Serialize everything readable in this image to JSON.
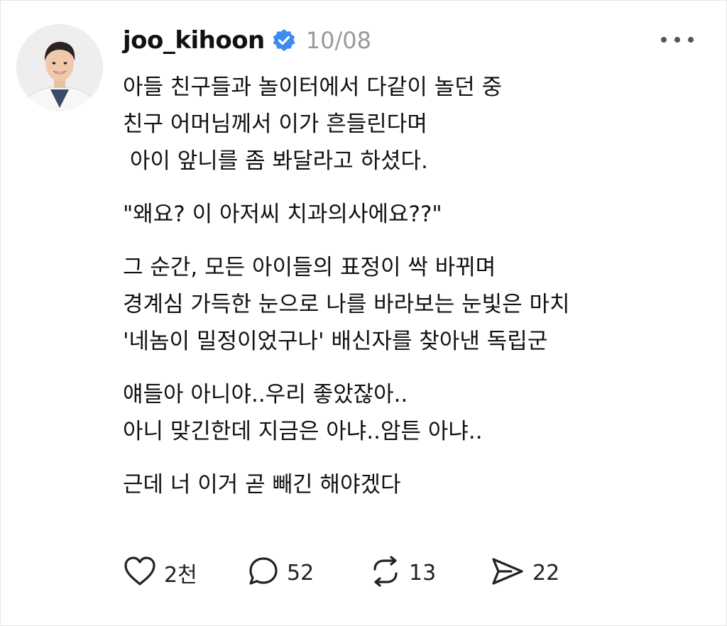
{
  "author": {
    "username": "joo_kihoon",
    "timestamp": "10/08"
  },
  "post": {
    "paragraphs": [
      [
        "아들 친구들과 놀이터에서 다같이 놀던 중",
        "친구 어머님께서 이가 흔들린다며",
        " 아이 앞니를 좀 봐달라고 하셨다."
      ],
      [
        "\"왜요? 이 아저씨 치과의사에요??\""
      ],
      [
        "그 순간, 모든 아이들의 표정이 싹 바뀌며",
        "경계심 가득한 눈으로 나를 바라보는 눈빛은 마치",
        "'네놈이 밀정이었구나' 배신자를 찾아낸 독립군"
      ],
      [
        "얘들아 아니야..우리 좋았잖아..",
        "아니 맞긴한데 지금은 아냐..암튼 아냐.."
      ],
      [
        "근데 너 이거 곧 빼긴 해야겠다"
      ]
    ]
  },
  "actions": {
    "likes": "2천",
    "replies": "52",
    "reposts": "13",
    "shares": "22"
  },
  "icons": {
    "verified": "verified-badge-icon",
    "more": "more-options-icon",
    "like": "heart-icon",
    "reply": "comment-icon",
    "repost": "repost-icon",
    "share": "send-icon"
  },
  "colors": {
    "verified_blue": "#3d8bf2",
    "timestamp_gray": "#9a9a9a"
  }
}
